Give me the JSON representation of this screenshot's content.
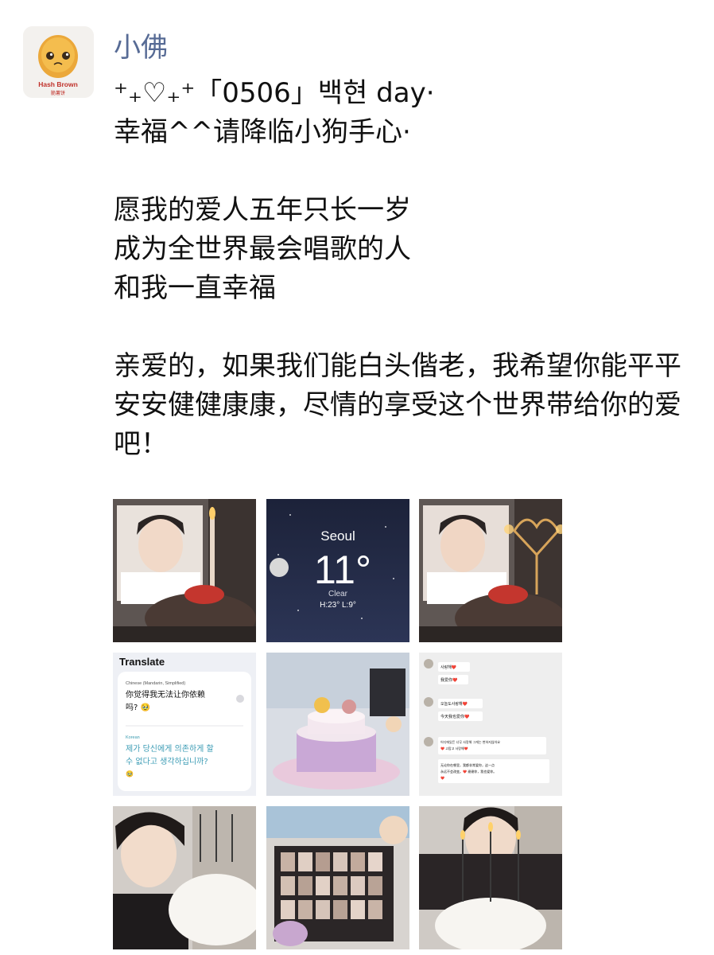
{
  "post": {
    "author": "小佛",
    "avatar": {
      "label": "Hash Brown",
      "sublabel": "脆薯饼"
    },
    "lines": [
      "⁺₊♡₊⁺「0506」백현 day·",
      "幸福^^请降临小狗手心·",
      "",
      "愿我的爱人五年只长一岁",
      "成为全世界最会唱歌的人",
      "和我一直幸福",
      "",
      "亲爱的，如果我们能白头偕老，我希望你能平平安安健健康康，尽情的享受这个世界带给你的爱吧！"
    ]
  },
  "photos": {
    "weather": {
      "city": "Seoul",
      "temp": "11°",
      "condition": "Clear",
      "range": "H:23° L:9°"
    },
    "translate": {
      "title": "Translate",
      "source_lang": "Chinese (Mandarin, Simplified)",
      "source_text": "你觉得我无法让你依赖吗? 🥹",
      "target_lang": "Korean",
      "target_text": "제가 당신에게 의존하게 할 수 없다고 생각하십니까? 🥹"
    },
    "chat": {
      "messages": [
        "사랑해❤️",
        "我爱你❤️",
        "오늘도사랑해❤️",
        "今天我也爱你❤️",
        "어디에있든 너무 사랑해 그게는 변하지않아요❤️ 고맙고 사랑해❤️",
        "无论你在哪里，我都非常爱你，这一点永远不会改变。❤️ 谢谢你，我也爱你。❤️"
      ]
    }
  },
  "colors": {
    "author": "#576b95",
    "text": "#111111",
    "background": "#ffffff"
  }
}
